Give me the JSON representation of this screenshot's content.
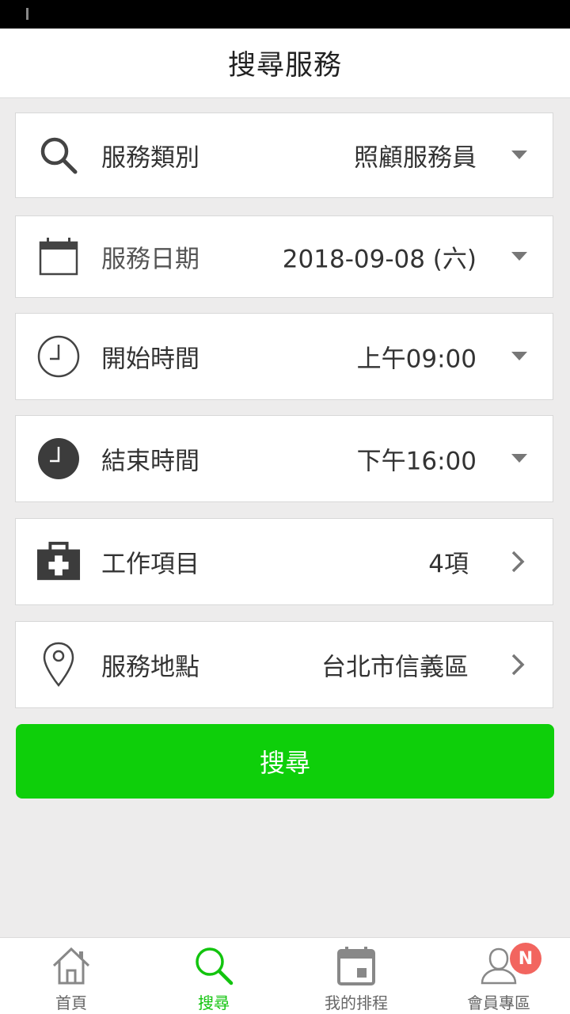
{
  "header": {
    "title": "搜尋服務"
  },
  "rows": [
    {
      "label": "服務類別",
      "value": "照顧服務員",
      "icon": "search-icon",
      "control": "dropdown"
    },
    {
      "label": "服務日期",
      "value": "2018-09-08 (六)",
      "icon": "calendar-icon",
      "control": "dropdown"
    },
    {
      "label": "開始時間",
      "value": "上午09:00",
      "icon": "clock-outline-icon",
      "control": "dropdown"
    },
    {
      "label": "結束時間",
      "value": "下午16:00",
      "icon": "clock-filled-icon",
      "control": "dropdown"
    },
    {
      "label": "工作項目",
      "value": "4項",
      "icon": "medical-kit-icon",
      "control": "chevron"
    },
    {
      "label": "服務地點",
      "value": "台北市信義區",
      "icon": "location-pin-icon",
      "control": "chevron"
    }
  ],
  "search_button": {
    "label": "搜尋"
  },
  "tabs": [
    {
      "label": "首頁",
      "icon": "home-icon",
      "active": false
    },
    {
      "label": "搜尋",
      "icon": "search-icon",
      "active": true
    },
    {
      "label": "我的排程",
      "icon": "calendar-icon",
      "active": false
    },
    {
      "label": "會員專區",
      "icon": "member-icon",
      "active": false,
      "badge": "N"
    }
  ],
  "colors": {
    "accent": "#0ecf0a",
    "badge": "#f2655f",
    "icon": "#444444"
  }
}
